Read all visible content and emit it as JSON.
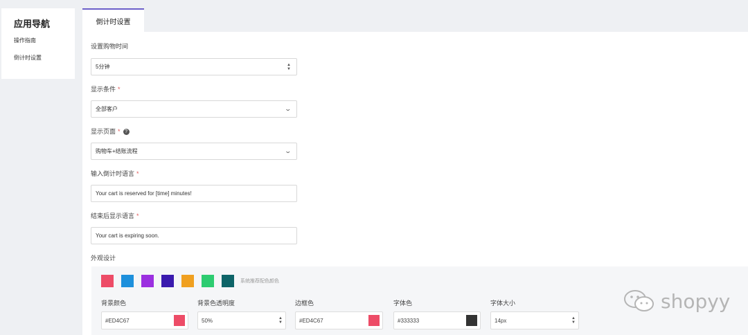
{
  "sidebar": {
    "title": "应用导航",
    "items": [
      {
        "label": "操作指南"
      },
      {
        "label": "倒计时设置"
      }
    ]
  },
  "tabs": [
    {
      "label": "倒计时设置",
      "active": true
    }
  ],
  "form": {
    "duration": {
      "label": "设置购物时间",
      "value": "5分钟"
    },
    "condition": {
      "label": "显示条件",
      "required": "*",
      "value": "全部客户"
    },
    "page": {
      "label": "显示页面",
      "required": "*",
      "value": "购物车+结账流程"
    },
    "countdown_text": {
      "label": "输入倒计时语言",
      "required": "*",
      "value": "Your cart is reserved for [time] minutes!"
    },
    "end_text": {
      "label": "结束后显示语言",
      "required": "*",
      "value": "Your cart is expiring soon."
    },
    "appearance": {
      "label": "外观设计",
      "swatches": [
        "#ED4C67",
        "#1E90DC",
        "#9B30E0",
        "#3A1AAE",
        "#F0A020",
        "#2ECC71",
        "#0E6468"
      ],
      "swatch_hint": "系统推荐配色颜色",
      "bg_color": {
        "label": "背景颜色",
        "value": "#ED4C67",
        "color": "#ED4C67"
      },
      "bg_opacity": {
        "label": "背景色透明度",
        "value": "50%"
      },
      "border_color": {
        "label": "边框色",
        "value": "#ED4C67",
        "color": "#ED4C67"
      },
      "font_color": {
        "label": "字体色",
        "value": "#333333",
        "color": "#333333"
      },
      "font_size": {
        "label": "字体大小",
        "value": "14px"
      }
    }
  },
  "watermark": {
    "text": "shopyy",
    "icon": "wechat-icon"
  }
}
